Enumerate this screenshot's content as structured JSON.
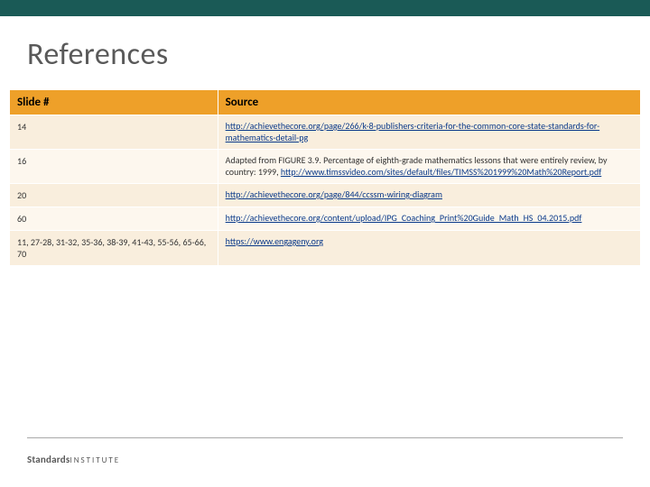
{
  "title": "References",
  "table": {
    "headers": {
      "slide": "Slide #",
      "source": "Source"
    },
    "rows": [
      {
        "slide": "14",
        "parts": [
          {
            "text": "http://achievethecore.org/page/266/k-8-publishers-criteria-for-the-common-core-state-standards-for-mathematics-detail-pg",
            "link": true
          }
        ]
      },
      {
        "slide": "16",
        "parts": [
          {
            "text": "Adapted from FIGURE 3.9. Percentage of eighth-grade mathematics lessons that were entirely review, by country: 1999, ",
            "link": false
          },
          {
            "text": "http://www.timssvideo.com/sites/default/files/TIMSS%201999%20Math%20Report.pdf",
            "link": true
          }
        ]
      },
      {
        "slide": "20",
        "parts": [
          {
            "text": "http://achievethecore.org/page/844/ccssm-wiring-diagram",
            "link": true
          }
        ]
      },
      {
        "slide": "60",
        "parts": [
          {
            "text": "http://achievethecore.org/content/upload/IPG_Coaching_Print%20Guide_Math_HS_04.2015.pdf",
            "link": true
          }
        ]
      },
      {
        "slide": "11, 27-28, 31-32, 35-36, 38-39, 41-43, 55-56, 65-66, 70",
        "parts": [
          {
            "text": "https://www.engageny.org",
            "link": true
          }
        ]
      }
    ]
  },
  "footer": {
    "brand_bold": "Standards",
    "brand_light": "INSTITUTE"
  }
}
